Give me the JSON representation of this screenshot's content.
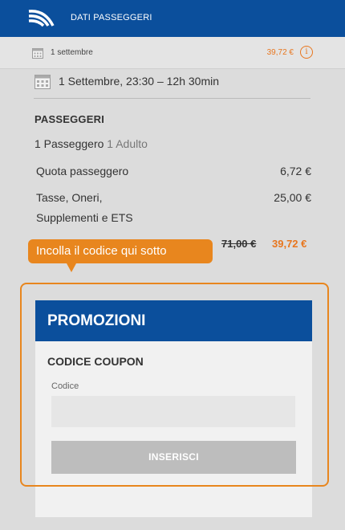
{
  "header": {
    "title": "DATI PASSEGGERI",
    "logo_icon": "brand-logo-icon"
  },
  "summary_bar": {
    "date": "1 settembre",
    "price": "39,72 €",
    "info_glyph": "i"
  },
  "trip": {
    "line": "1 Settembre, 23:30 – 12h 30min"
  },
  "passengers": {
    "title": "PASSEGGERI",
    "count": "1 Passeggero",
    "type": "1 Adulto",
    "quota_label": "Quota passeggero",
    "quota_value": "6,72 €",
    "tax_label_1": "Tasse, Oneri,",
    "tax_label_2": "Supplementi e ETS",
    "tax_value": "25,00 €",
    "old_total": "71,00 €",
    "new_total": "39,72 €"
  },
  "tooltip": {
    "text": "Incolla il codice qui sotto"
  },
  "promo": {
    "title": "PROMOZIONI",
    "coupon_title": "CODICE COUPON",
    "code_label": "Codice",
    "code_value": "",
    "button_label": "INSERISCI"
  },
  "colors": {
    "brand_blue": "#0b4f9c",
    "accent_orange": "#e8861e",
    "price_orange": "#e8761e"
  }
}
